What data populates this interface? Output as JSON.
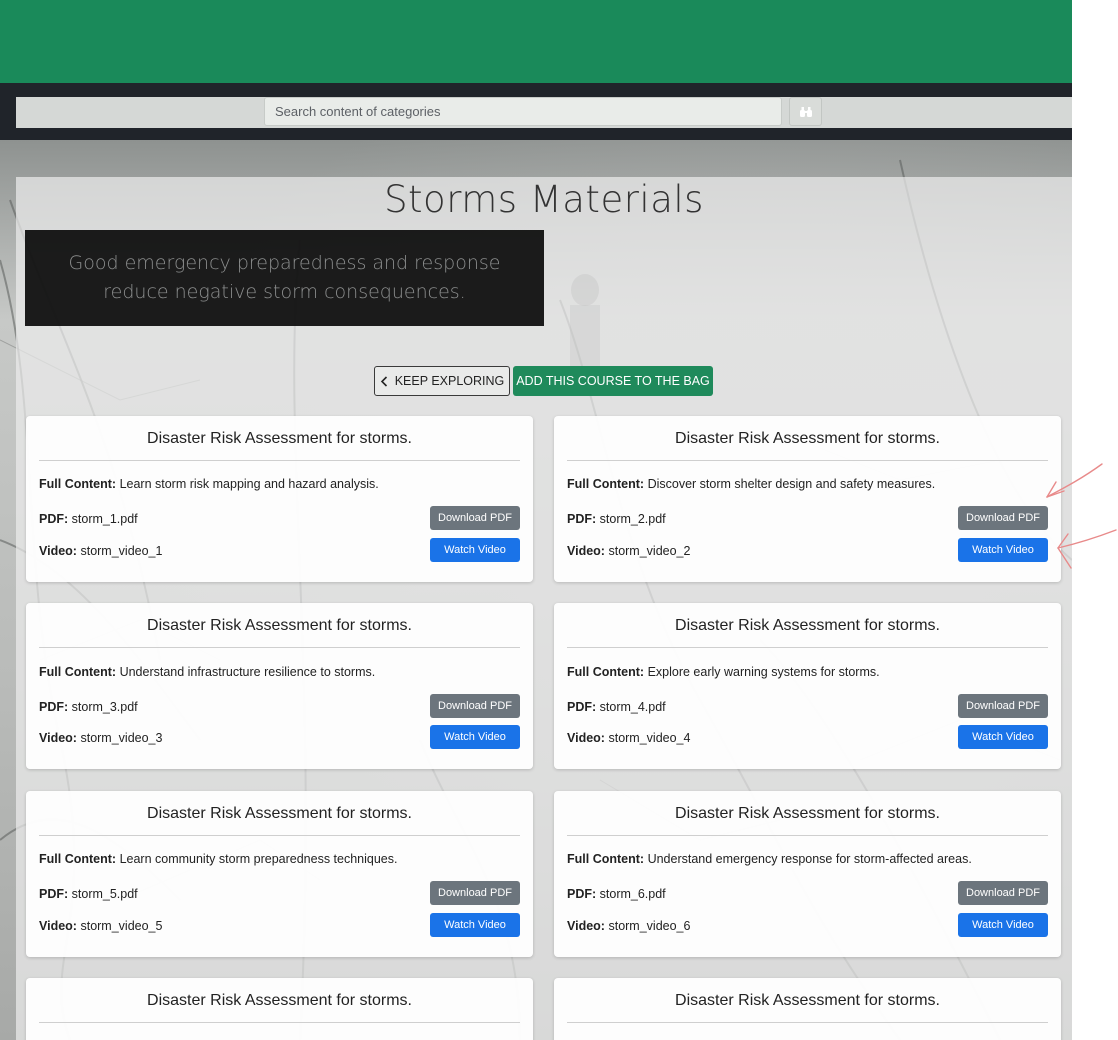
{
  "search": {
    "placeholder": "Search content of categories"
  },
  "page": {
    "title": "Storms Materials",
    "tagline": "Good emergency preparedness and response reduce negative storm consequences."
  },
  "actions": {
    "keep_exploring": "KEEP EXPLORING",
    "add_to_bag": "ADD THIS COURSE TO THE BAG"
  },
  "labels": {
    "full_content": "Full Content:",
    "pdf": "PDF:",
    "video": "Video:",
    "download_pdf": "Download PDF",
    "watch_video": "Watch Video"
  },
  "cards": [
    {
      "title": "Disaster Risk Assessment for storms.",
      "content": "Learn storm risk mapping and hazard analysis.",
      "pdf": "storm_1.pdf",
      "video": "storm_video_1"
    },
    {
      "title": "Disaster Risk Assessment for storms.",
      "content": "Discover storm shelter design and safety measures.",
      "pdf": "storm_2.pdf",
      "video": "storm_video_2"
    },
    {
      "title": "Disaster Risk Assessment for storms.",
      "content": "Understand infrastructure resilience to storms.",
      "pdf": "storm_3.pdf",
      "video": "storm_video_3"
    },
    {
      "title": "Disaster Risk Assessment for storms.",
      "content": "Explore early warning systems for storms.",
      "pdf": "storm_4.pdf",
      "video": "storm_video_4"
    },
    {
      "title": "Disaster Risk Assessment for storms.",
      "content": "Learn community storm preparedness techniques.",
      "pdf": "storm_5.pdf",
      "video": "storm_video_5"
    },
    {
      "title": "Disaster Risk Assessment for storms.",
      "content": "Understand emergency response for storm-affected areas.",
      "pdf": "storm_6.pdf",
      "video": "storm_video_6"
    },
    {
      "title": "Disaster Risk Assessment for storms."
    },
    {
      "title": "Disaster Risk Assessment for storms."
    }
  ],
  "colors": {
    "brand_green": "#1a8a5a",
    "navbar": "#20242a",
    "pdf_button": "#6c757d",
    "video_button": "#1a73e8",
    "annotation_arrows": "#e88a8a"
  },
  "icons": {
    "search_button": "binoculars-icon",
    "back": "chevron-left-icon"
  }
}
